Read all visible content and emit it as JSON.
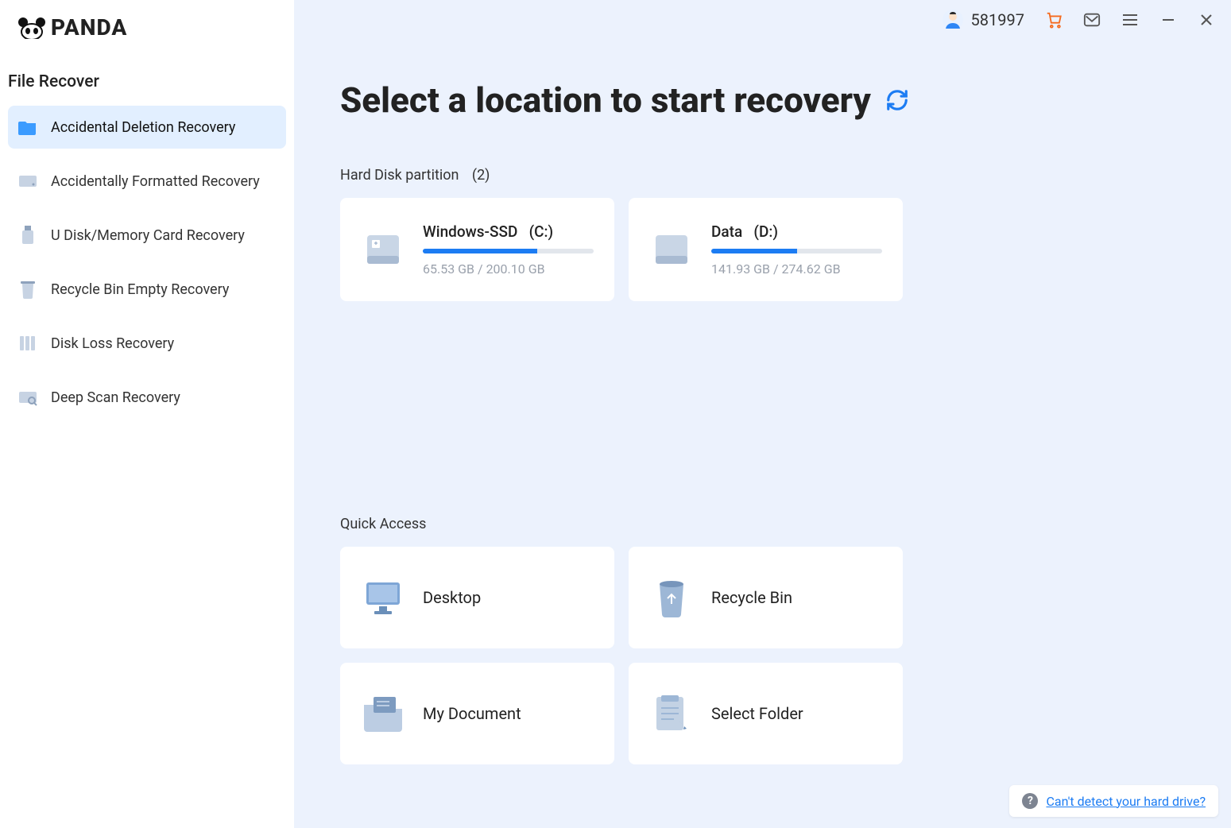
{
  "brand": "PANDA",
  "sidebar": {
    "title": "File Recover",
    "items": [
      {
        "label": "Accidental Deletion Recovery"
      },
      {
        "label": "Accidentally Formatted Recovery"
      },
      {
        "label": "U Disk/Memory Card Recovery"
      },
      {
        "label": "Recycle Bin Empty Recovery"
      },
      {
        "label": "Disk Loss Recovery"
      },
      {
        "label": "Deep Scan Recovery"
      }
    ]
  },
  "topbar": {
    "user_id": "581997"
  },
  "main": {
    "title": "Select a location to start recovery",
    "partitions_label": "Hard Disk partition",
    "partitions_count": "(2)",
    "partitions": [
      {
        "name": "Windows-SSD",
        "letter": "(C:)",
        "usage": "65.53 GB / 200.10 GB",
        "percent": 67
      },
      {
        "name": "Data",
        "letter": "(D:)",
        "usage": "141.93 GB / 274.62 GB",
        "percent": 50
      }
    ],
    "quick_access_label": "Quick Access",
    "quick_access": [
      {
        "label": "Desktop"
      },
      {
        "label": "Recycle Bin"
      },
      {
        "label": "My Document"
      },
      {
        "label": "Select Folder"
      }
    ],
    "help_text": "Can't detect your hard drive?"
  }
}
